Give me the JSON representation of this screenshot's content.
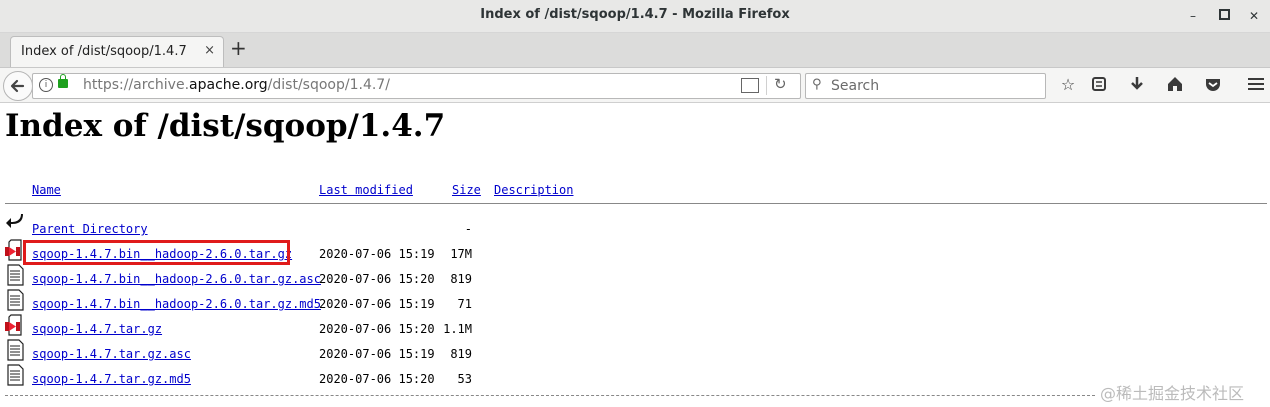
{
  "window": {
    "title": "Index of /dist/sqoop/1.4.7 - Mozilla Firefox"
  },
  "tab": {
    "label": "Index of /dist/sqoop/1.4.7",
    "close_glyph": "×",
    "new_tab_glyph": "+"
  },
  "navbar": {
    "url_prefix": "https://archive.",
    "url_domain": "apache.org",
    "url_suffix": "/dist/sqoop/1.4.7/",
    "search_placeholder": "Search"
  },
  "page": {
    "heading": "Index of /dist/sqoop/1.4.7",
    "columns": {
      "name": "Name",
      "last_modified": "Last modified",
      "size": "Size",
      "description": "Description"
    },
    "parent": {
      "name": "Parent Directory",
      "size": "-"
    },
    "files": [
      {
        "name": "sqoop-1.4.7.bin__hadoop-2.6.0.tar.gz",
        "modified": "2020-07-06 15:19",
        "size": "17M",
        "icon": "archive-icon"
      },
      {
        "name": "sqoop-1.4.7.bin__hadoop-2.6.0.tar.gz.asc",
        "modified": "2020-07-06 15:20",
        "size": "819",
        "icon": "text-file-icon"
      },
      {
        "name": "sqoop-1.4.7.bin__hadoop-2.6.0.tar.gz.md5",
        "modified": "2020-07-06 15:19",
        "size": "71",
        "icon": "text-file-icon"
      },
      {
        "name": "sqoop-1.4.7.tar.gz",
        "modified": "2020-07-06 15:20",
        "size": "1.1M",
        "icon": "archive-icon"
      },
      {
        "name": "sqoop-1.4.7.tar.gz.asc",
        "modified": "2020-07-06 15:19",
        "size": "819",
        "icon": "text-file-icon"
      },
      {
        "name": "sqoop-1.4.7.tar.gz.md5",
        "modified": "2020-07-06 15:20",
        "size": "53",
        "icon": "text-file-icon"
      }
    ]
  },
  "watermark": "@稀土掘金技术社区",
  "colors": {
    "link": "#0000cc",
    "highlight": "#e01b1b",
    "lock": "#1ea01e"
  }
}
